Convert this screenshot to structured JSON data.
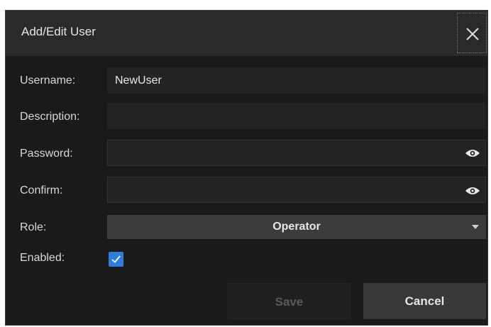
{
  "dialog": {
    "title": "Add/Edit User",
    "close_icon": "close-icon"
  },
  "form": {
    "username": {
      "label": "Username:",
      "value": "NewUser"
    },
    "description": {
      "label": "Description:",
      "value": ""
    },
    "password": {
      "label": "Password:",
      "value": "",
      "reveal_icon": "eye-icon"
    },
    "confirm": {
      "label": "Confirm:",
      "value": "",
      "reveal_icon": "eye-icon"
    },
    "role": {
      "label": "Role:",
      "value": "Operator",
      "dropdown_icon": "caret-down-icon"
    },
    "enabled": {
      "label": "Enabled:",
      "checked": true,
      "check_color": "#2f7ddb"
    }
  },
  "actions": {
    "save_label": "Save",
    "cancel_label": "Cancel"
  }
}
